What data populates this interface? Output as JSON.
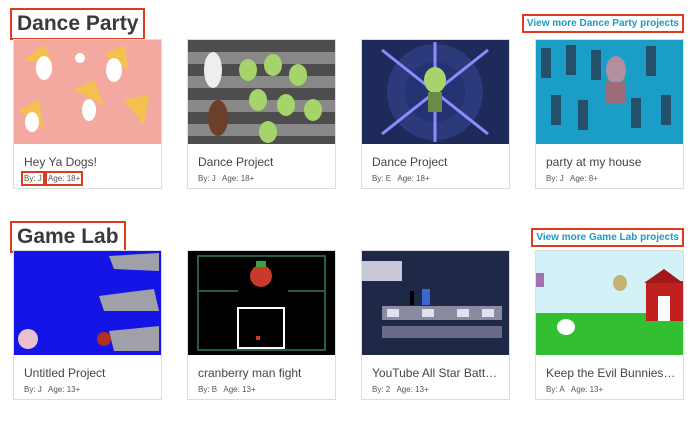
{
  "sections": [
    {
      "title": "Dance Party",
      "more": "View more Dance Party projects",
      "cards": [
        {
          "title": "Hey Ya Dogs!",
          "by": "By: J",
          "age": "Age: 18+"
        },
        {
          "title": "Dance Project",
          "by": "By: J",
          "age": "Age: 18+"
        },
        {
          "title": "Dance Project",
          "by": "By: E",
          "age": "Age: 18+"
        },
        {
          "title": "party at my house",
          "by": "By: J",
          "age": "Age: 8+"
        }
      ]
    },
    {
      "title": "Game Lab",
      "more": "View more Game Lab projects",
      "cards": [
        {
          "title": "Untitled Project",
          "by": "By: J",
          "age": "Age: 13+"
        },
        {
          "title": "cranberry man fight",
          "by": "By: B",
          "age": "Age: 13+"
        },
        {
          "title": "YouTube All Star Batt…",
          "by": "By: 2",
          "age": "Age: 13+"
        },
        {
          "title": "Keep the Evil Bunnies…",
          "by": "By: A",
          "age": "Age: 13+"
        }
      ]
    }
  ]
}
